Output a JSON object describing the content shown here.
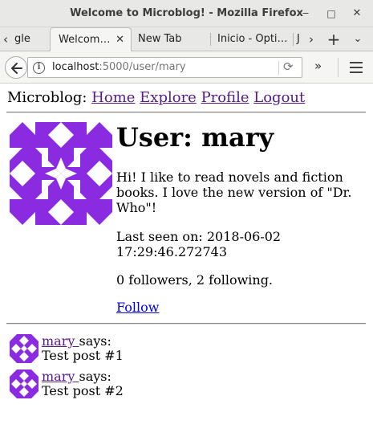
{
  "window": {
    "title": "Welcome to Microblog! - Mozilla Firefox",
    "minimize_icon": "minimize-icon",
    "maximize_icon": "maximize-icon",
    "close_icon": "close-icon"
  },
  "tabs": [
    {
      "label": "gle",
      "active": false
    },
    {
      "label": "Welcom…",
      "active": true
    },
    {
      "label": "New Tab",
      "active": false
    },
    {
      "label": "Inicio - Opti…",
      "active": false
    },
    {
      "label": "J",
      "active": false
    }
  ],
  "toolbar": {
    "url_host": "localhost",
    "url_path": ":5000/user/mary"
  },
  "nav": {
    "brand": "Microblog:",
    "links": [
      "Home",
      "Explore",
      "Profile",
      "Logout"
    ]
  },
  "profile": {
    "title": "User: mary",
    "about": "Hi! I like to read novels and fiction books. I love the new version of \"Dr. Who\"!",
    "last_seen": "Last seen on: 2018-06-02 17:29:46.272743",
    "follow_counts": "0 followers, 2 following.",
    "follow_link": "Follow",
    "avatar_color": "#8a2be2"
  },
  "posts": [
    {
      "author": "mary ",
      "says": "says:",
      "body": "Test post #1"
    },
    {
      "author": "mary ",
      "says": "says:",
      "body": "Test post #2"
    }
  ]
}
